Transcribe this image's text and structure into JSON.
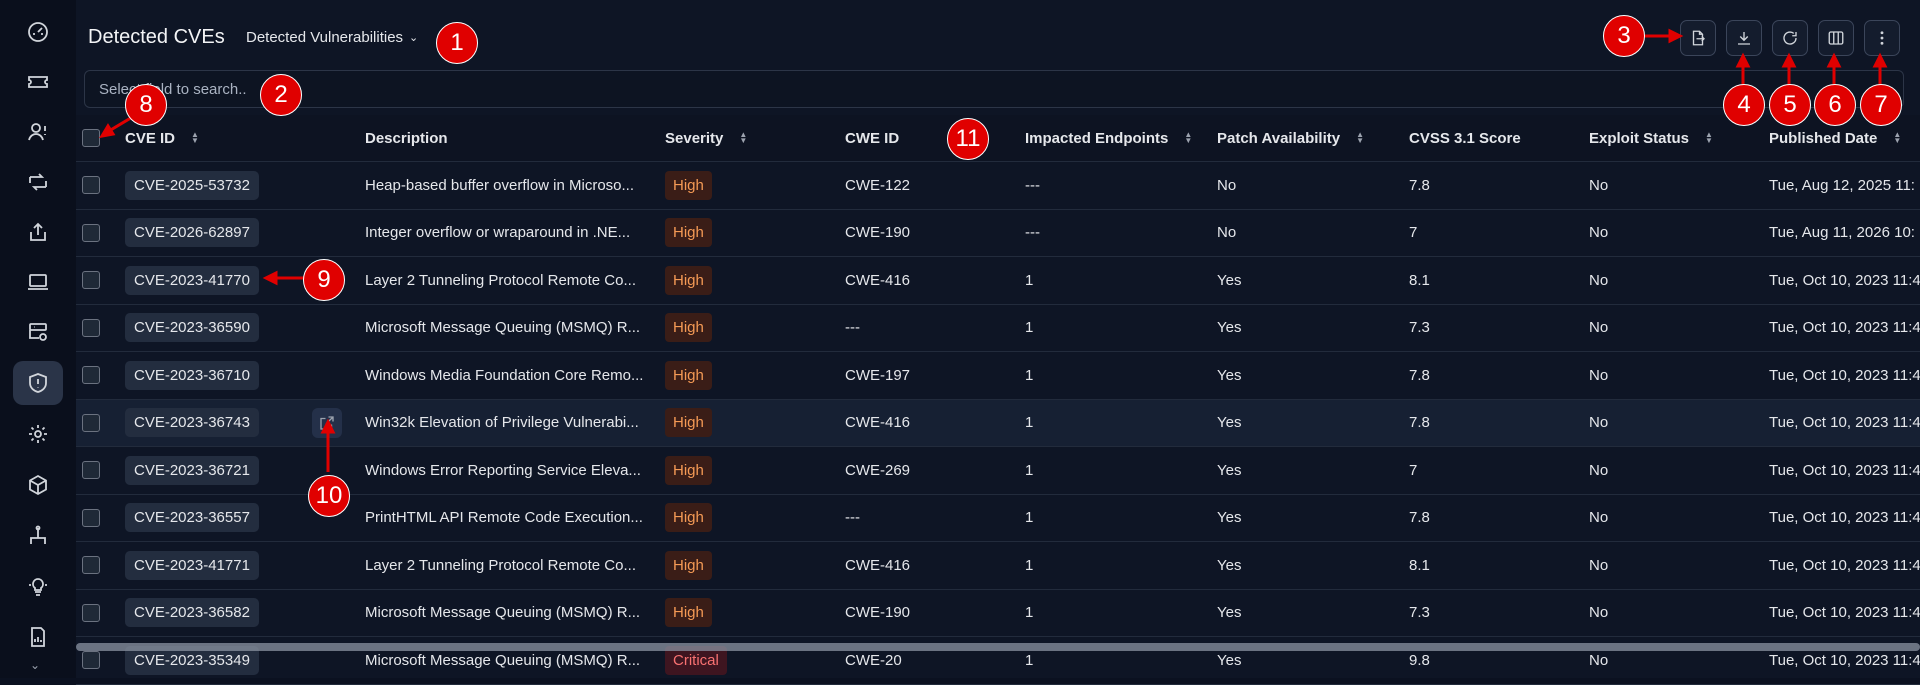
{
  "sidebar": {
    "items": [
      {
        "icon": "dashboard-icon"
      },
      {
        "icon": "ticket-icon"
      },
      {
        "icon": "user-alert-icon"
      },
      {
        "icon": "sync-icon"
      },
      {
        "icon": "upload-icon"
      },
      {
        "icon": "laptop-icon"
      },
      {
        "icon": "database-settings-icon"
      },
      {
        "icon": "shield-alert-icon",
        "active": true
      },
      {
        "icon": "gear-flower-icon"
      },
      {
        "icon": "cube-icon"
      },
      {
        "icon": "network-tree-icon"
      },
      {
        "icon": "lightbulb-icon"
      },
      {
        "icon": "report-icon"
      }
    ],
    "more": "⌄"
  },
  "header": {
    "title": "Detected CVEs",
    "view_select": "Detected Vulnerabilities",
    "view_chevron": "⌄"
  },
  "toolbar": [
    "export-icon",
    "download-icon",
    "refresh-icon",
    "columns-icon",
    "more-vertical-icon"
  ],
  "search": {
    "placeholder": "Select field to search..",
    "value": ""
  },
  "table": {
    "columns": [
      "CVE ID",
      "Description",
      "Severity",
      "CWE ID",
      "Impacted Endpoints",
      "Patch Availability",
      "CVSS 3.1 Score",
      "Exploit Status",
      "Published Date"
    ],
    "rows": [
      {
        "cve": "CVE-2025-53732",
        "desc": "Heap-based buffer overflow in Microso...",
        "sev": "High",
        "cwe": "CWE-122",
        "endpoints": "---",
        "patch": "No",
        "cvss": "7.8",
        "exploit": "No",
        "date": "Tue, Aug 12, 2025 11:"
      },
      {
        "cve": "CVE-2026-62897",
        "desc": "Integer overflow or wraparound in .NE...",
        "sev": "High",
        "cwe": "CWE-190",
        "endpoints": "---",
        "patch": "No",
        "cvss": "7",
        "exploit": "No",
        "date": "Tue, Aug 11, 2026 10:"
      },
      {
        "cve": "CVE-2023-41770",
        "desc": "Layer 2 Tunneling Protocol Remote Co...",
        "sev": "High",
        "cwe": "CWE-416",
        "endpoints": "1",
        "patch": "Yes",
        "cvss": "8.1",
        "exploit": "No",
        "date": "Tue, Oct 10, 2023 11:4"
      },
      {
        "cve": "CVE-2023-36590",
        "desc": "Microsoft Message Queuing (MSMQ) R...",
        "sev": "High",
        "cwe": "---",
        "endpoints": "1",
        "patch": "Yes",
        "cvss": "7.3",
        "exploit": "No",
        "date": "Tue, Oct 10, 2023 11:4"
      },
      {
        "cve": "CVE-2023-36710",
        "desc": "Windows Media Foundation Core Remo...",
        "sev": "High",
        "cwe": "CWE-197",
        "endpoints": "1",
        "patch": "Yes",
        "cvss": "7.8",
        "exploit": "No",
        "date": "Tue, Oct 10, 2023 11:4"
      },
      {
        "cve": "CVE-2023-36743",
        "desc": "Win32k Elevation of Privilege Vulnerabi...",
        "sev": "High",
        "cwe": "CWE-416",
        "endpoints": "1",
        "patch": "Yes",
        "cvss": "7.8",
        "exploit": "No",
        "date": "Tue, Oct 10, 2023 11:4"
      },
      {
        "cve": "CVE-2023-36721",
        "desc": "Windows Error Reporting Service Eleva...",
        "sev": "High",
        "cwe": "CWE-269",
        "endpoints": "1",
        "patch": "Yes",
        "cvss": "7",
        "exploit": "No",
        "date": "Tue, Oct 10, 2023 11:4"
      },
      {
        "cve": "CVE-2023-36557",
        "desc": "PrintHTML API Remote Code Execution...",
        "sev": "High",
        "cwe": "---",
        "endpoints": "1",
        "patch": "Yes",
        "cvss": "7.8",
        "exploit": "No",
        "date": "Tue, Oct 10, 2023 11:4"
      },
      {
        "cve": "CVE-2023-41771",
        "desc": "Layer 2 Tunneling Protocol Remote Co...",
        "sev": "High",
        "cwe": "CWE-416",
        "endpoints": "1",
        "patch": "Yes",
        "cvss": "8.1",
        "exploit": "No",
        "date": "Tue, Oct 10, 2023 11:4"
      },
      {
        "cve": "CVE-2023-36582",
        "desc": "Microsoft Message Queuing (MSMQ) R...",
        "sev": "High",
        "cwe": "CWE-190",
        "endpoints": "1",
        "patch": "Yes",
        "cvss": "7.3",
        "exploit": "No",
        "date": "Tue, Oct 10, 2023 11:4"
      },
      {
        "cve": "CVE-2023-35349",
        "desc": "Microsoft Message Queuing (MSMQ) R...",
        "sev": "Critical",
        "cwe": "CWE-20",
        "endpoints": "1",
        "patch": "Yes",
        "cvss": "9.8",
        "exploit": "No",
        "date": "Tue, Oct 10, 2023 11:4"
      }
    ]
  },
  "callouts": [
    "1",
    "2",
    "3",
    "4",
    "5",
    "6",
    "7",
    "8",
    "9",
    "10",
    "11"
  ],
  "colors": {
    "callout": "#e00000",
    "high": "#f59a55",
    "critical": "#f87171",
    "background": "#0e1525"
  }
}
